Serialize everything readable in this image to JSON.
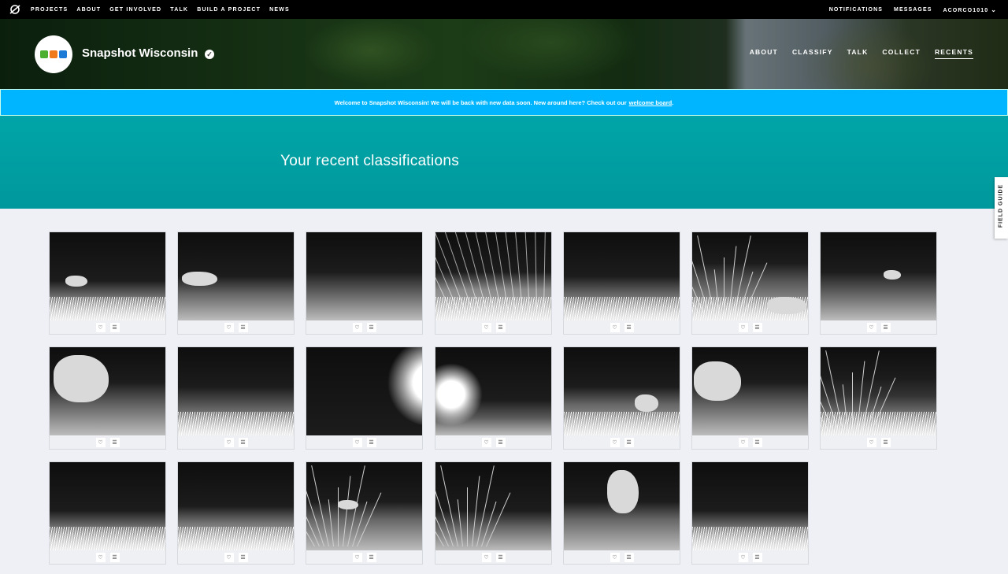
{
  "topnav": {
    "items": [
      "PROJECTS",
      "ABOUT",
      "GET INVOLVED",
      "TALK",
      "BUILD A PROJECT",
      "NEWS"
    ],
    "right": {
      "notifications": "NOTIFICATIONS",
      "messages": "MESSAGES",
      "user": "ACORCO1010"
    }
  },
  "project": {
    "title": "Snapshot Wisconsin",
    "nav": [
      "ABOUT",
      "CLASSIFY",
      "TALK",
      "COLLECT",
      "RECENTS"
    ],
    "active_nav": "RECENTS"
  },
  "banner": {
    "text": "Welcome to Snapshot Wisconsin! We will be back with new data soon. New around here? Check out our",
    "link": "welcome board",
    "end": "."
  },
  "page": {
    "heading": "Your recent classifications"
  },
  "field_guide": "FIELD GUIDE",
  "icons": {
    "favorite": "heart-icon",
    "collect": "list-icon"
  },
  "colors": {
    "teal": "#00a0a3",
    "banner": "#00b5ff",
    "topbar": "#000000"
  },
  "classifications_count": 20
}
